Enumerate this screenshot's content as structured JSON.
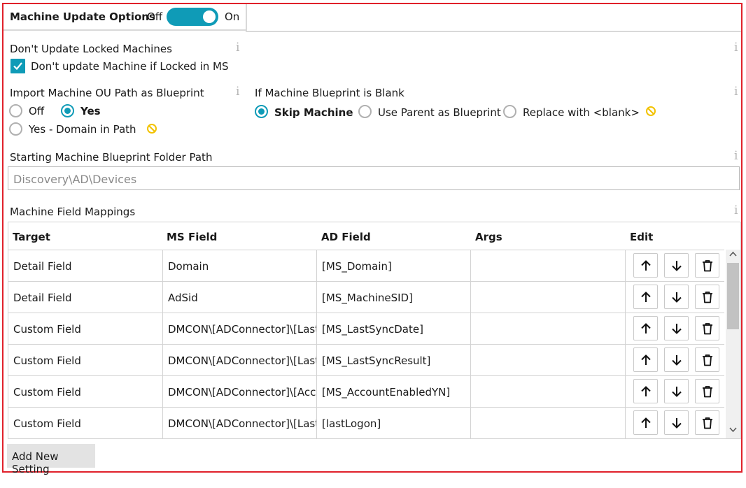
{
  "header": {
    "title": "Machine Update Options",
    "toggle_off": "Off",
    "toggle_on": "On",
    "toggle_state": "on"
  },
  "locked": {
    "section_label": "Don't Update Locked Machines",
    "checkbox_label": "Don't update Machine if Locked in MS",
    "checked": true
  },
  "import_ou": {
    "section_label": "Import Machine OU Path as Blueprint",
    "options": [
      "Off",
      "Yes",
      "Yes - Domain in Path"
    ],
    "selected": "Yes"
  },
  "blank_blueprint": {
    "section_label": "If Machine Blueprint is Blank",
    "options": [
      "Skip Machine",
      "Use Parent as Blueprint",
      "Replace with <blank>"
    ],
    "selected": "Skip Machine"
  },
  "folder_path": {
    "label": "Starting Machine Blueprint Folder Path",
    "value": "Discovery\\AD\\Devices"
  },
  "mappings": {
    "label": "Machine Field Mappings",
    "columns": [
      "Target",
      "MS Field",
      "AD Field",
      "Args",
      "Edit"
    ],
    "rows": [
      {
        "target": "Detail Field",
        "ms_field": "Domain",
        "ad_field": "[MS_Domain]",
        "args": ""
      },
      {
        "target": "Detail Field",
        "ms_field": "AdSid",
        "ad_field": "[MS_MachineSID]",
        "args": ""
      },
      {
        "target": "Custom Field",
        "ms_field": "DMCON\\[ADConnector]\\[LastSy",
        "ad_field": "[MS_LastSyncDate]",
        "args": ""
      },
      {
        "target": "Custom Field",
        "ms_field": "DMCON\\[ADConnector]\\[LastSy",
        "ad_field": "[MS_LastSyncResult]",
        "args": ""
      },
      {
        "target": "Custom Field",
        "ms_field": "DMCON\\[ADConnector]\\[Accou",
        "ad_field": "[MS_AccountEnabledYN]",
        "args": ""
      },
      {
        "target": "Custom Field",
        "ms_field": "DMCON\\[ADConnector]\\[LastLc",
        "ad_field": "[lastLogon]",
        "args": ""
      }
    ]
  },
  "add_button": "Add New Setting",
  "icons": {
    "info": "info-icon",
    "no_entry": "no-entry-icon",
    "up": "arrow-up-icon",
    "down": "arrow-down-icon",
    "delete": "trash-icon"
  },
  "colors": {
    "accent": "#0f9bb7",
    "frame": "#e0202a",
    "warning": "#f2c200"
  }
}
